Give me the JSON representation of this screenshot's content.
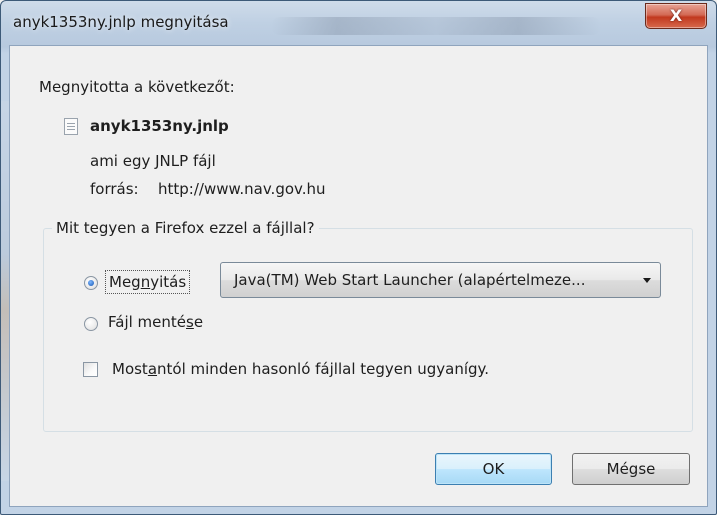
{
  "window": {
    "title": "anyk1353ny.jnlp megnyitása",
    "close_glyph": "X"
  },
  "dialog": {
    "intro": "Megnyitotta a következőt:",
    "file_icon": "document-icon",
    "filename": "anyk1353ny.jnlp",
    "type_line": "ami egy  JNLP fájl",
    "from_label": "forrás:",
    "from_value": "http://www.nav.gov.hu"
  },
  "action_group": {
    "legend": "Mit tegyen a Firefox ezzel a fájllal?",
    "open_option": {
      "label_before": "Meg",
      "label_mnemonic": "n",
      "label_after": "yitás",
      "selected": true
    },
    "open_with": {
      "selected_value": "Java(TM) Web Start Launcher (alapértelmeze..."
    },
    "save_option": {
      "label_before": "Fájl menté",
      "label_mnemonic": "s",
      "label_after": "e",
      "selected": false
    },
    "remember": {
      "label_before": "Most",
      "label_mnemonic": "a",
      "label_after": "ntól minden hasonló fájllal tegyen ugyanígy.",
      "checked": false
    }
  },
  "buttons": {
    "ok_label": "OK",
    "cancel_label": "Mégse"
  },
  "colors": {
    "title_bar": "#bfd0e3",
    "close_button": "#c2391f",
    "dialog_background": "#f0f0f0",
    "default_button_border": "#3c7fb1"
  }
}
